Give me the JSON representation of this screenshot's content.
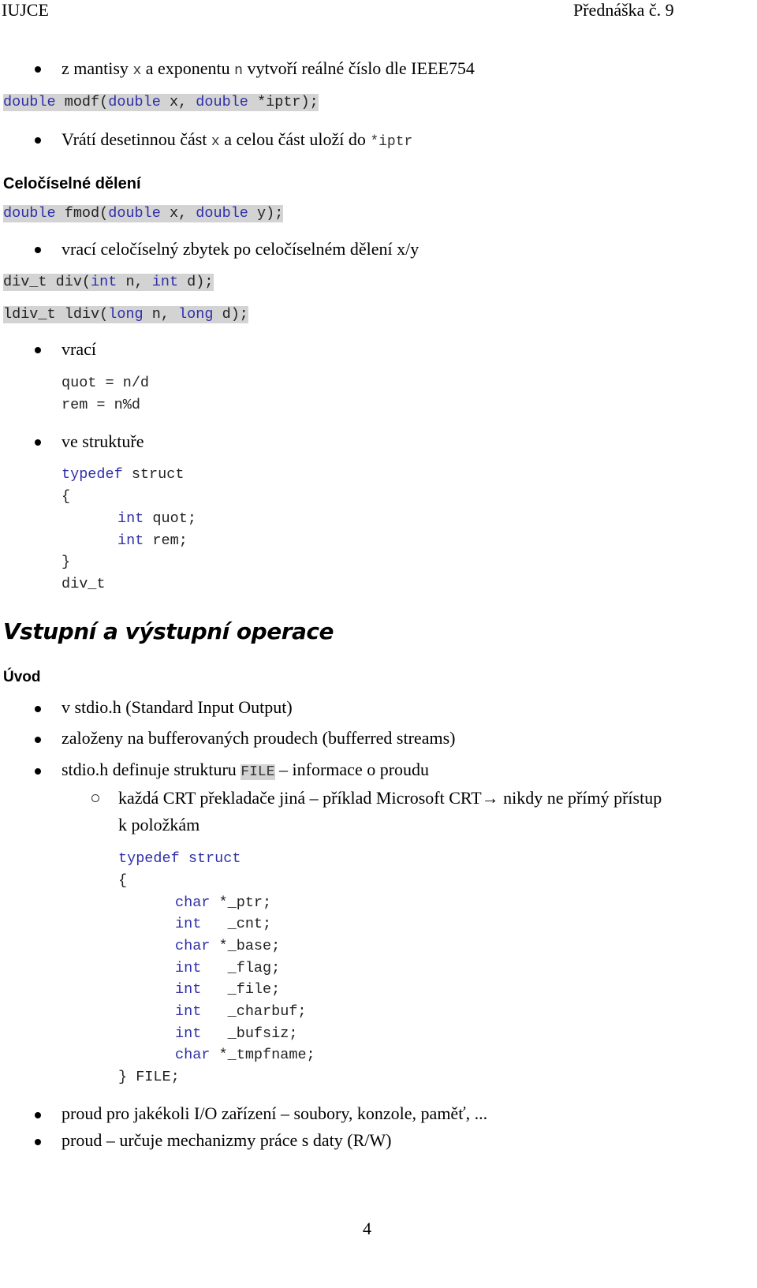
{
  "header": {
    "left": "IUJCE",
    "right": "Přednáška č. 9"
  },
  "s1": {
    "pre": "z mantisy ",
    "x": "x",
    "mid": " a exponentu ",
    "n": "n",
    "post": " vytvoří reálné číslo dle IEEE754"
  },
  "modf": {
    "t1": "double",
    "t2": " modf(",
    "t3": "double",
    "t4": " x, ",
    "t5": "double",
    "t6": " *iptr);"
  },
  "s2": {
    "pre": "Vrátí desetinnou část ",
    "x": "x",
    "mid": " a celou část uloží do ",
    "code": "*iptr"
  },
  "h_int": "Celočíselné dělení",
  "fmod": {
    "t1": "double",
    "t2": " fmod(",
    "t3": "double",
    "t4": " x, ",
    "t5": "double",
    "t6": " y);"
  },
  "s3": "vrací celočíselný zbytek po celočíselném dělení x/y",
  "div": {
    "t1": "div_t div(",
    "t2": "int",
    "t3": " n, ",
    "t4": "int",
    "t5": " d);"
  },
  "ldiv": {
    "t1": "ldiv_t ldiv(",
    "t2": "long",
    "t3": " n, ",
    "t4": "long",
    "t5": " d);"
  },
  "s4": "vrací",
  "quot": "quot = n/d",
  "rem": "rem = n%d",
  "s5": "ve struktuře",
  "divt": {
    "kw": "typedef",
    "struct": " struct",
    "open": "{",
    "int": "int",
    "f1": " quot;",
    "f2": " rem;",
    "close": "}",
    "name": "div_t"
  },
  "h_io": "Vstupní a výstupní operace",
  "h_uvod": "Úvod",
  "u1": "v stdio.h (Standard Input Output)",
  "u2": "založeny na bufferovaných proudech (bufferred streams)",
  "u3": {
    "pre": "stdio.h definuje strukturu ",
    "code": "FILE",
    "post": " – informace o proudu"
  },
  "u3sub": {
    "line1": "každá CRT překladače jiná – příklad Microsoft CRT→ nikdy ne přímý přístup",
    "line2": "k položkám"
  },
  "file": {
    "kw": "typedef struct",
    "open": "{",
    "fields": [
      {
        "type": "char",
        "rest": " *_ptr;"
      },
      {
        "type": "int",
        "rest": "   _cnt;"
      },
      {
        "type": "char",
        "rest": " *_base;"
      },
      {
        "type": "int",
        "rest": "   _flag;"
      },
      {
        "type": "int",
        "rest": "   _file;"
      },
      {
        "type": "int",
        "rest": "   _charbuf;"
      },
      {
        "type": "int",
        "rest": "   _bufsiz;"
      },
      {
        "type": "char",
        "rest": " *_tmpfname;"
      }
    ],
    "close": "} FILE;"
  },
  "b1": "proud pro jakékoli I/O zařízení – soubory, konzole, paměť, ...",
  "b2": "proud – určuje mechanizmy práce s daty (R/W)",
  "page_number": "4"
}
